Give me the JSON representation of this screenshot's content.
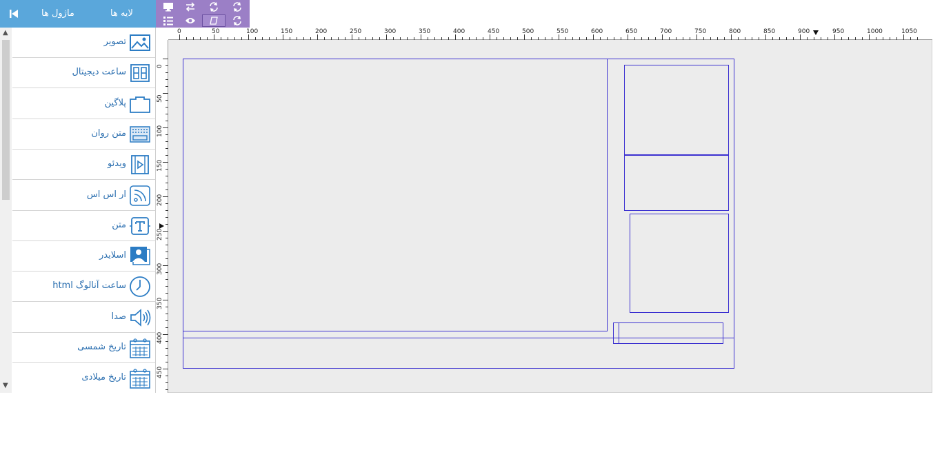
{
  "panel": {
    "tabs": [
      {
        "label": "ماژول ها"
      },
      {
        "label": "لایه ها"
      }
    ],
    "collapse_icon": "skip-back-icon"
  },
  "toolbar": {
    "buttons": [
      {
        "icon": "monitor-icon"
      },
      {
        "icon": "swap-arrows-icon"
      },
      {
        "icon": "refresh-icon"
      },
      {
        "icon": "refresh-icon"
      },
      {
        "icon": "list-icon"
      },
      {
        "icon": "eye-icon"
      },
      {
        "icon": "shape-icon"
      },
      {
        "icon": "refresh-icon"
      }
    ]
  },
  "modules": [
    {
      "label": "تصویر",
      "icon": "image-icon"
    },
    {
      "label": "ساعت دیجیتال",
      "icon": "digital-clock-icon"
    },
    {
      "label": "پلاگین",
      "icon": "plugin-icon"
    },
    {
      "label": "متن روان",
      "icon": "marquee-text-icon"
    },
    {
      "label": "ویدئو",
      "icon": "video-icon"
    },
    {
      "label": "ار اس اس",
      "icon": "rss-icon"
    },
    {
      "label": "متن",
      "icon": "text-icon"
    },
    {
      "label": "اسلایدر",
      "icon": "slider-icon"
    },
    {
      "label": "ساعت آنالوگ html",
      "icon": "analog-clock-icon"
    },
    {
      "label": "صدا",
      "icon": "speaker-icon"
    },
    {
      "label": "تاریخ شمسی",
      "icon": "calendar-icon"
    },
    {
      "label": "تاریخ میلادی",
      "icon": "calendar-icon"
    }
  ],
  "ruler_top": [
    "0",
    "50",
    "100",
    "150",
    "200",
    "250",
    "300",
    "350",
    "400",
    "450",
    "500",
    "550",
    "600",
    "650",
    "700",
    "750",
    "800",
    "850",
    "900",
    "950",
    "1000",
    "1050"
  ],
  "ruler_left": [
    "0",
    "50",
    "100",
    "150",
    "200",
    "250",
    "300",
    "350",
    "400",
    "450"
  ],
  "colors": {
    "panel": "#5aa7db",
    "toolbar": "#9b7fc6",
    "zone_border": "#3a2fd0",
    "label": "#2b6fb0"
  }
}
